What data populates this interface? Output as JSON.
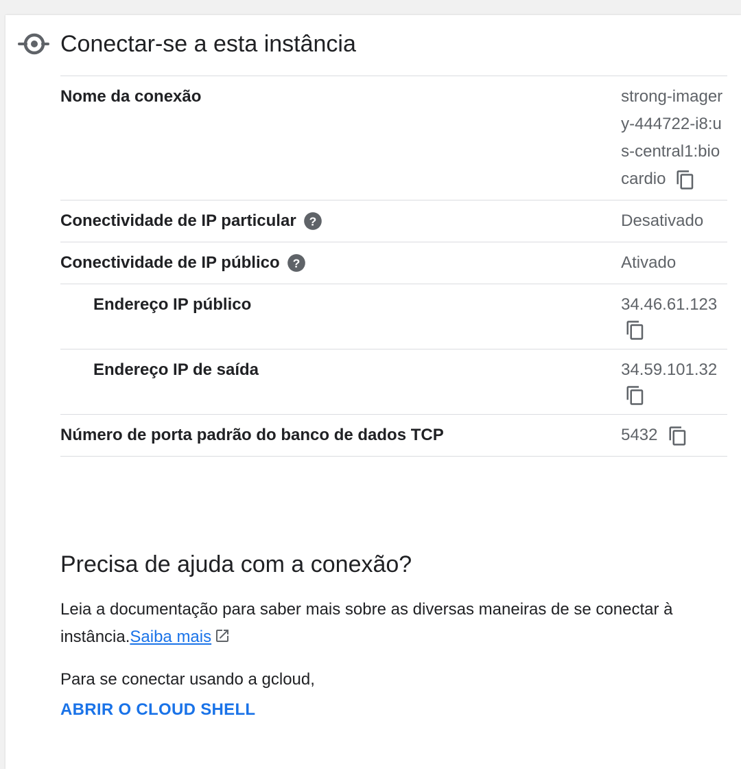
{
  "header": {
    "title": "Conectar-se a esta instância",
    "icon": "connection-icon"
  },
  "rows": {
    "connection_name": {
      "label": "Nome da conexão",
      "value": "strong-imagery-444722-i8:us-central1:biocardio"
    },
    "private_ip": {
      "label": "Conectividade de IP particular",
      "value": "Desativado"
    },
    "public_ip": {
      "label": "Conectividade de IP público",
      "value": "Ativado"
    },
    "public_address": {
      "label": "Endereço IP público",
      "value": "34.46.61.123"
    },
    "outgoing_address": {
      "label": "Endereço IP de saída",
      "value": "34.59.101.32"
    },
    "tcp_port": {
      "label": "Número de porta padrão do banco de dados TCP",
      "value": "5432"
    }
  },
  "help": {
    "title": "Precisa de ajuda com a conexão?",
    "description": "Leia a documentação para saber mais sobre as diversas maneiras de se conectar à instância.",
    "link_label": "Saiba mais",
    "gcloud_text": "Para se conectar usando a gcloud,",
    "shell_button": "ABRIR O CLOUD SHELL"
  },
  "colors": {
    "accent": "#1a73e8",
    "text_primary": "#202124",
    "text_secondary": "#5f6368",
    "divider": "#dadce0",
    "icon": "#5f6368"
  }
}
